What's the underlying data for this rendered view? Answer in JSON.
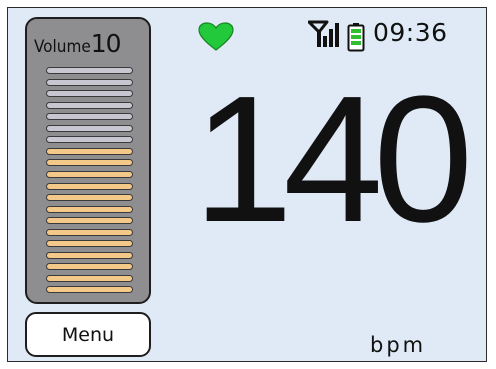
{
  "volume": {
    "label": "Volume",
    "value": "10",
    "total_segments": 20,
    "active_segments": 13,
    "active_color": "#f4c888",
    "inactive_color": "#c8c6d0"
  },
  "menu": {
    "label": "Menu"
  },
  "status": {
    "heart_icon": "heart-icon",
    "heart_color": "#22c93a",
    "signal_icon": "signal-icon",
    "battery_icon": "battery-icon",
    "battery_color": "#2fbf2f",
    "time": "09:36"
  },
  "reading": {
    "value": "140",
    "unit": "bpm"
  }
}
